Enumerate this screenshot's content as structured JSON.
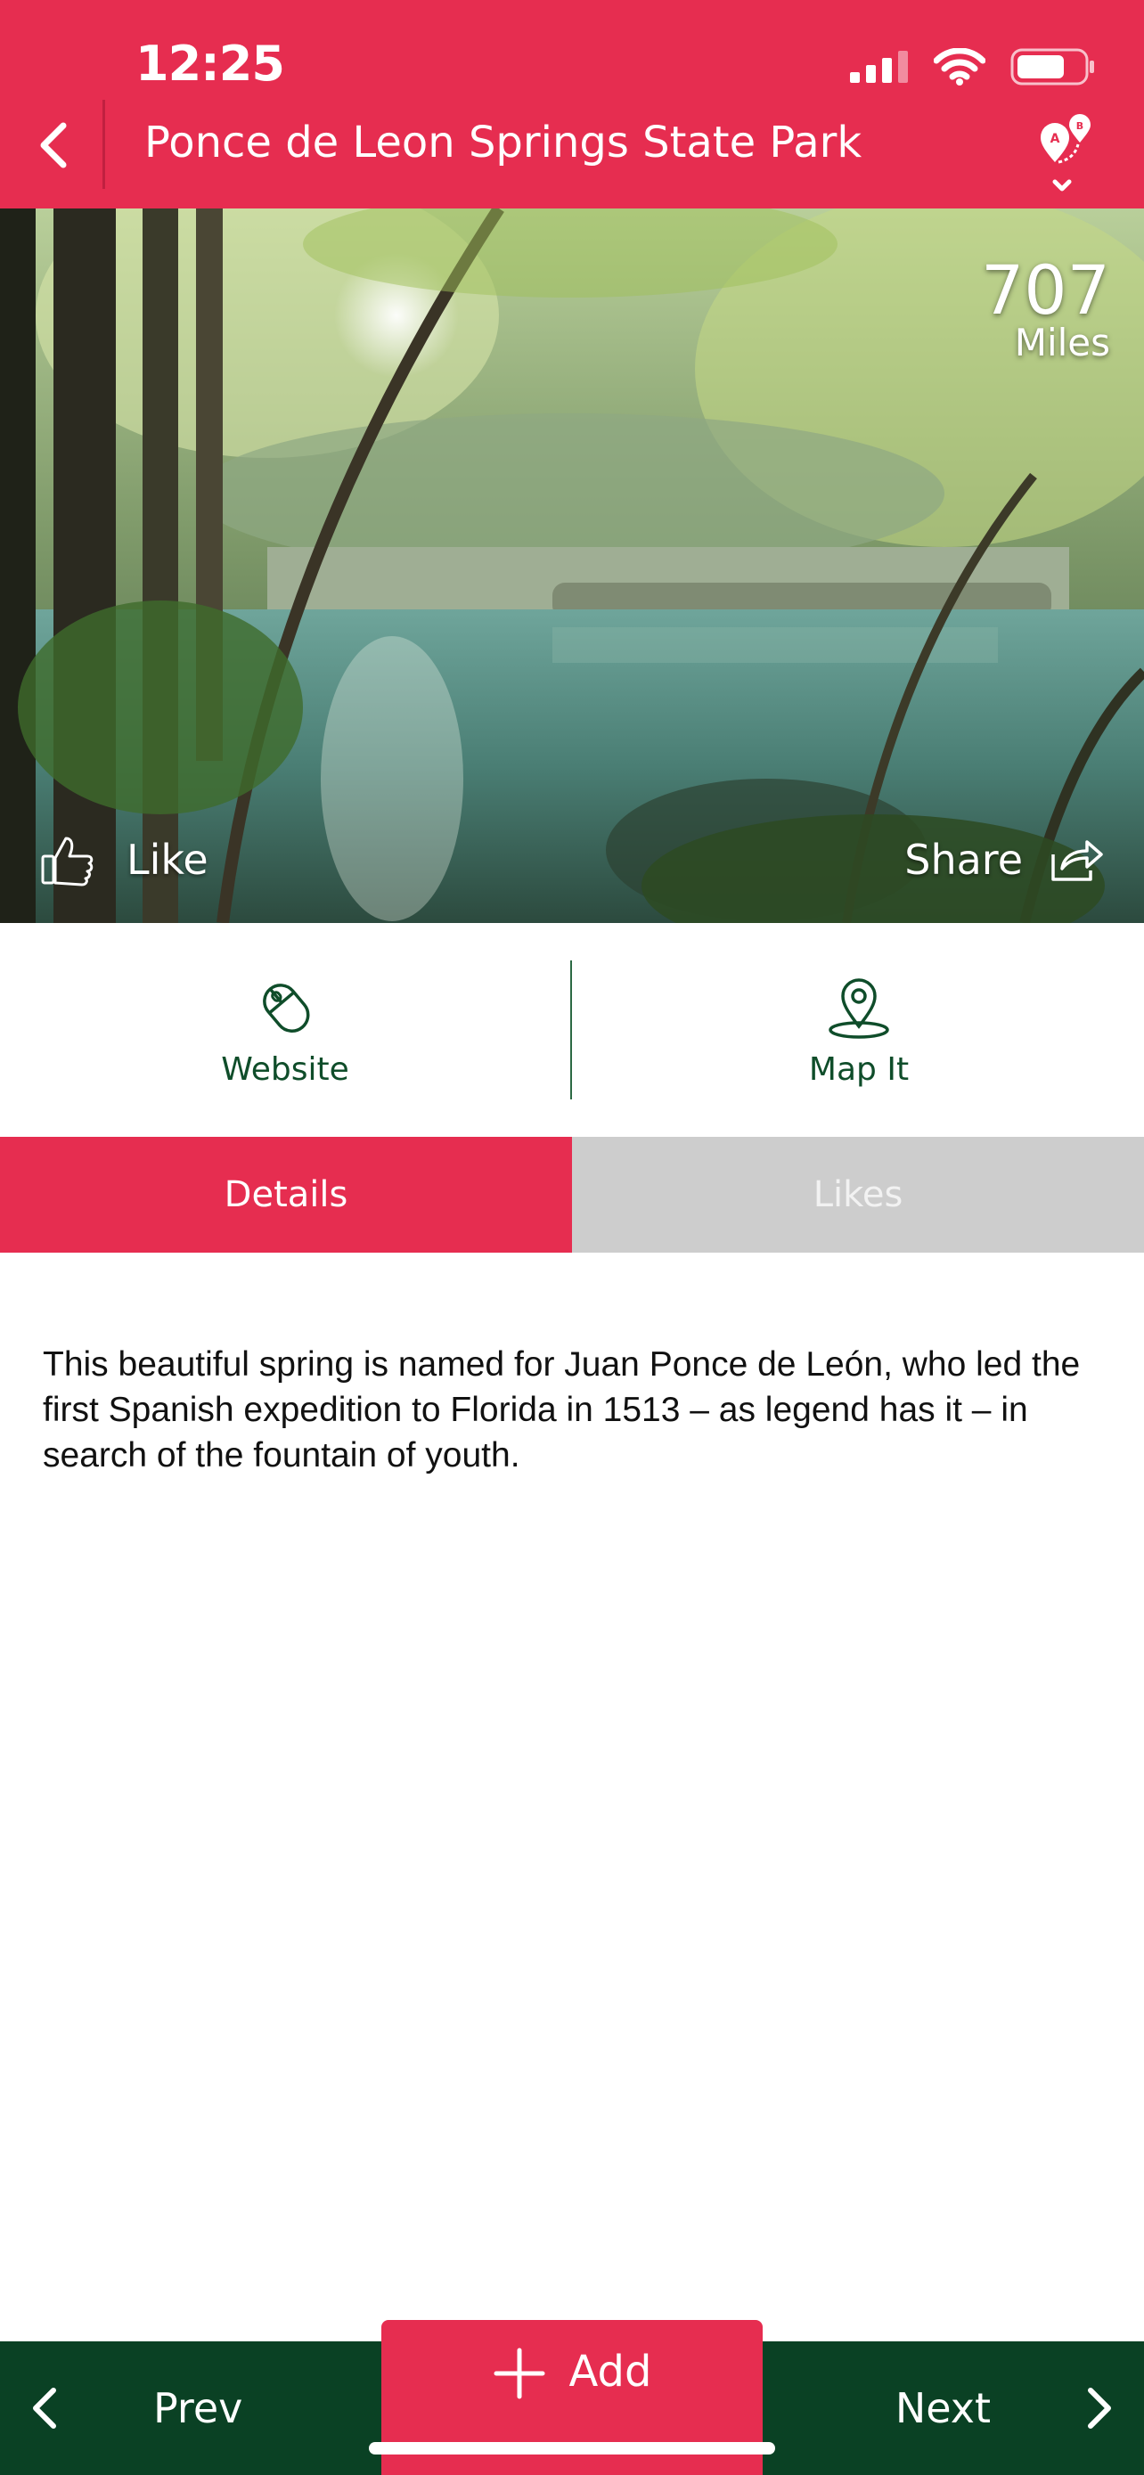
{
  "status_bar": {
    "time": "12:25"
  },
  "header": {
    "title": "Ponce de Leon Springs State Park"
  },
  "hero": {
    "distance_value": "707",
    "distance_unit": "Miles",
    "like_label": "Like",
    "share_label": "Share"
  },
  "actions": {
    "website_label": "Website",
    "map_label": "Map It"
  },
  "tabs": {
    "details_label": "Details",
    "likes_label": "Likes"
  },
  "description": "This beautiful spring is named for Juan Ponce de León, who led the first Spanish expedition to Florida in 1513 – as legend has it – in search of the fountain of youth.",
  "bottom_nav": {
    "prev_label": "Prev",
    "add_label": "Add",
    "next_label": "Next"
  },
  "colors": {
    "accent_red": "#e62d50",
    "dark_green": "#0a4124",
    "tab_inactive": "#cdcdcd"
  }
}
